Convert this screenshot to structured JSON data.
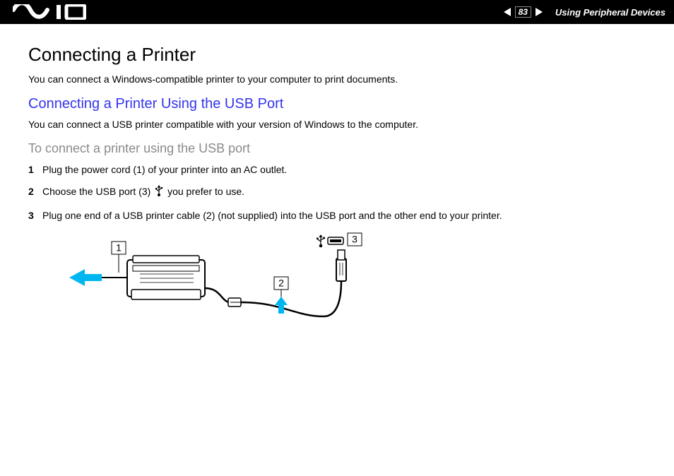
{
  "header": {
    "page_number": "83",
    "section_title": "Using Peripheral Devices"
  },
  "content": {
    "title": "Connecting a Printer",
    "intro": "You can connect a Windows-compatible printer to your computer to print documents.",
    "sub_blue": "Connecting a Printer Using the USB Port",
    "sub_intro": "You can connect a USB printer compatible with your version of Windows to the computer.",
    "sub_gray": "To connect a printer using the USB port",
    "steps": {
      "s1": "Plug the power cord (1) of your printer into an AC outlet.",
      "s2a": "Choose the USB port (3) ",
      "s2b": " you prefer to use.",
      "s3": "Plug one end of a USB printer cable (2) (not supplied) into the USB port and the other end to your printer."
    },
    "diagram": {
      "label1": "1",
      "label2": "2",
      "label3": "3"
    }
  }
}
